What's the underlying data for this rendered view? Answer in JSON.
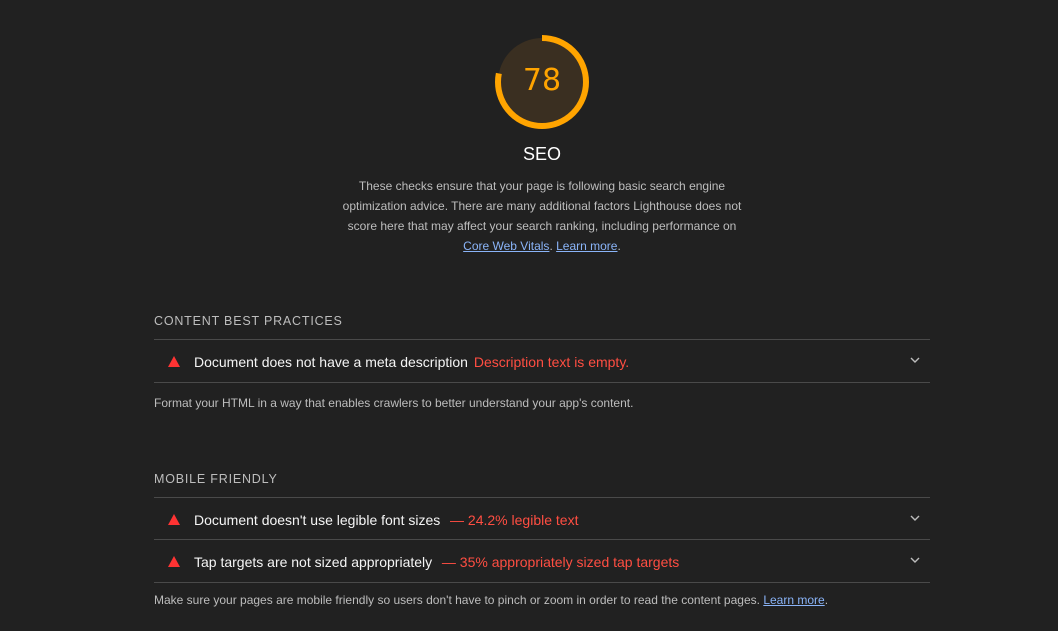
{
  "category": {
    "score": "78",
    "score_fraction": 0.78,
    "score_color": "#ffa400",
    "title": "SEO",
    "description_text": "These checks ensure that your page is following basic search engine optimization advice. There are many additional factors Lighthouse does not score here that may affect your search ranking, including performance on ",
    "link_cwv": "Core Web Vitals",
    "sep": ". ",
    "link_learn": "Learn more",
    "end": "."
  },
  "groups": [
    {
      "title": "CONTENT BEST PRACTICES",
      "audits": [
        {
          "title": "Document does not have a meta description",
          "display": "Description text is empty.",
          "icon": "fail-triangle-icon"
        }
      ],
      "description": "Format your HTML in a way that enables crawlers to better understand your app's content."
    },
    {
      "title": "MOBILE FRIENDLY",
      "audits": [
        {
          "title": "Document doesn't use legible font sizes",
          "display": "— 24.2% legible text",
          "icon": "fail-triangle-icon"
        },
        {
          "title": "Tap targets are not sized appropriately",
          "display": "— 35% appropriately sized tap targets",
          "icon": "fail-triangle-icon"
        }
      ],
      "description": "Make sure your pages are mobile friendly so users don't have to pinch or zoom in order to read the content pages. ",
      "link": "Learn more",
      "end": "."
    }
  ],
  "colors": {
    "background": "#212121",
    "fail": "#ff3333",
    "link": "#8ab4f8"
  }
}
